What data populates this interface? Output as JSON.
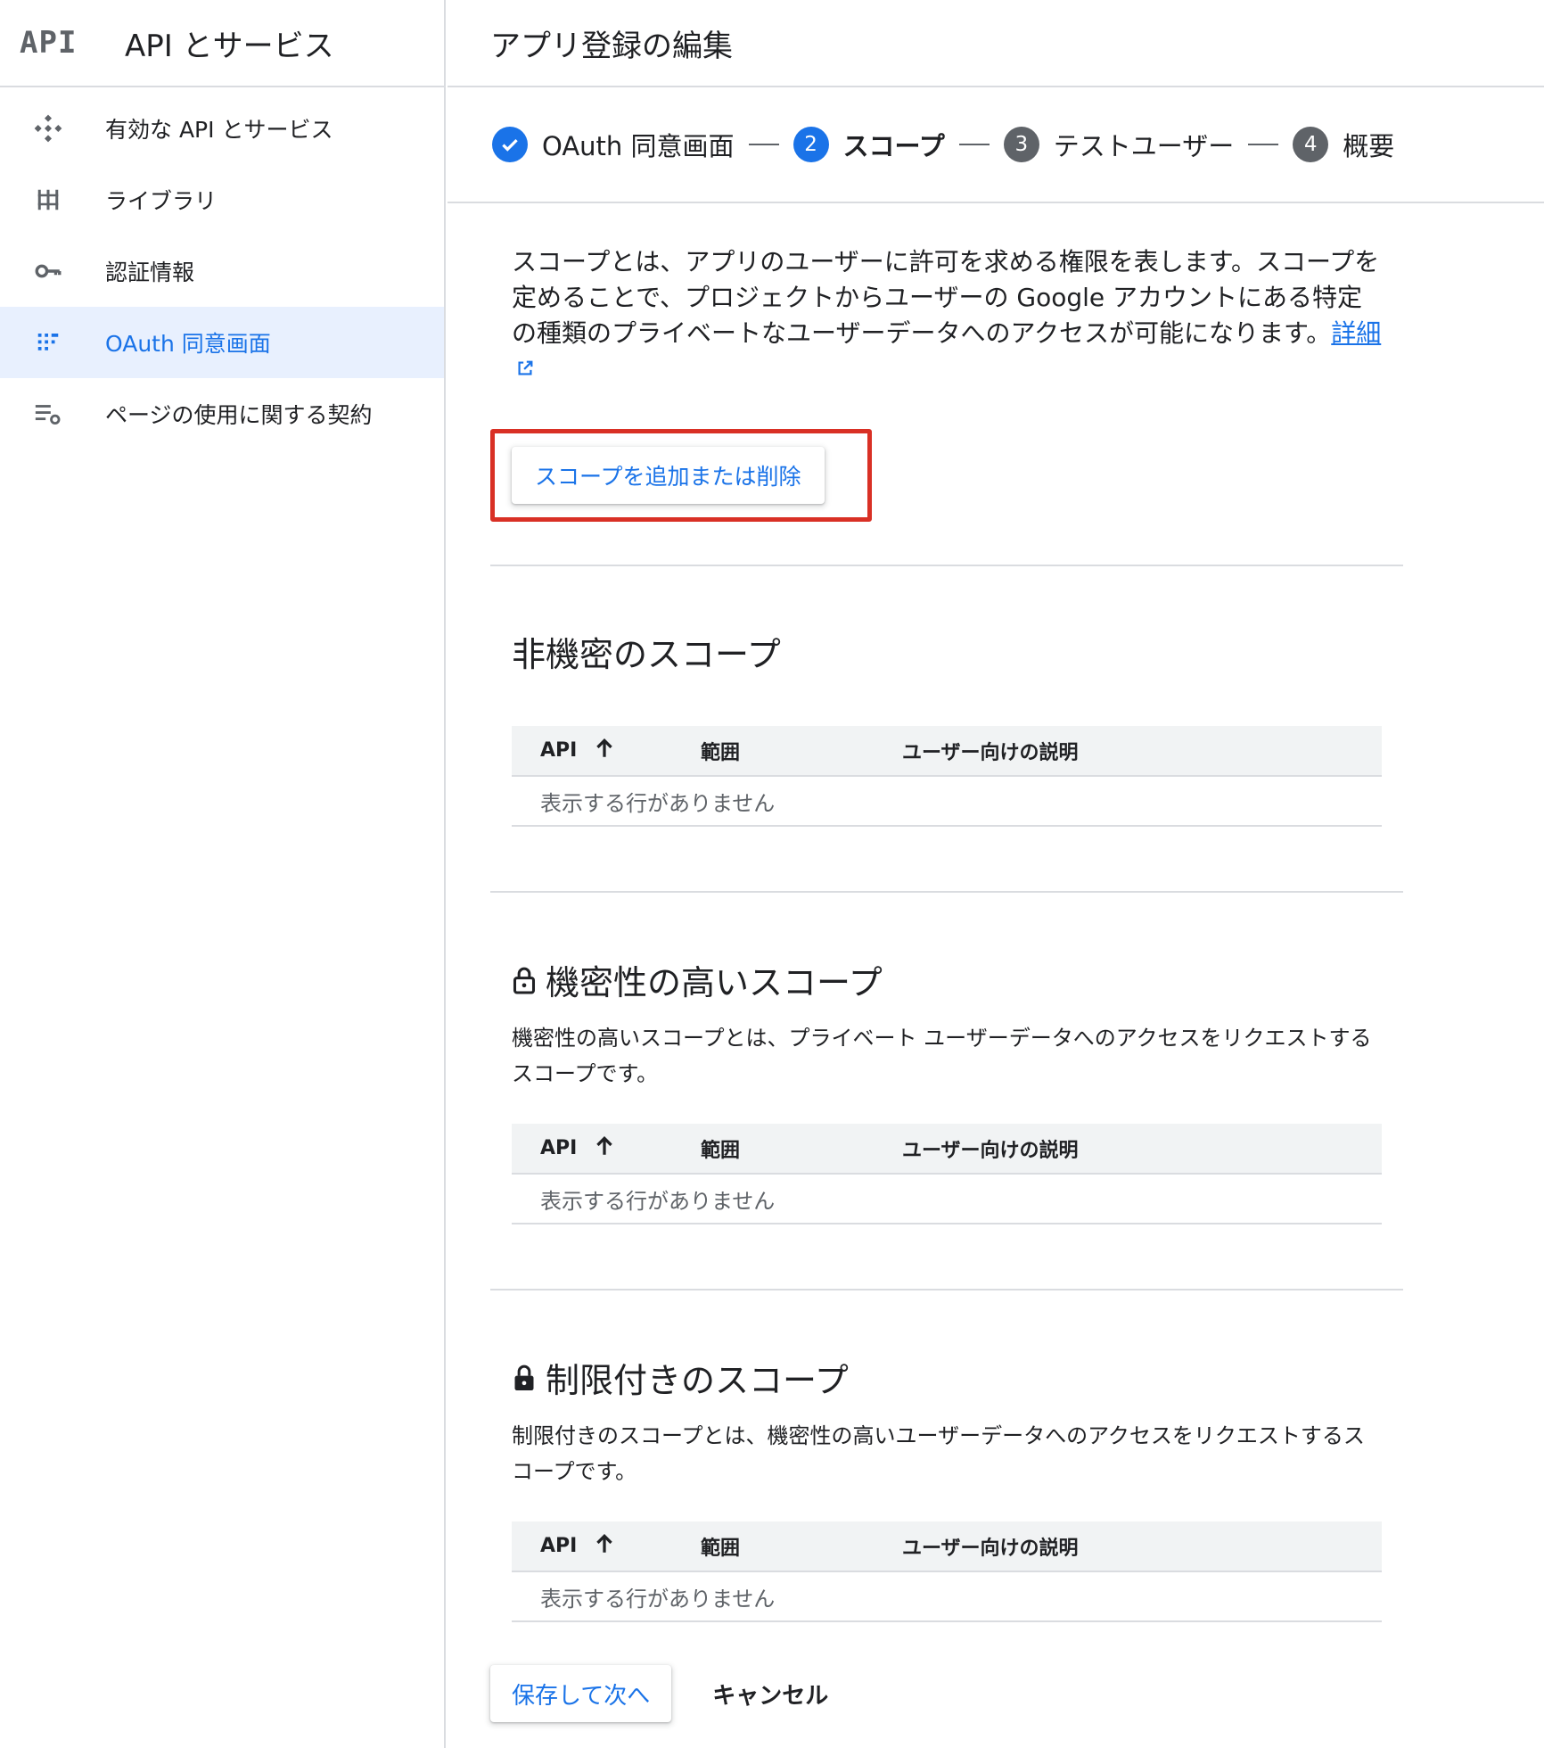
{
  "sidebar": {
    "logo_text": "API",
    "title": "API とサービス",
    "items": [
      {
        "label": "有効な API とサービス",
        "icon": "diamond-grid-icon"
      },
      {
        "label": "ライブラリ",
        "icon": "library-icon"
      },
      {
        "label": "認証情報",
        "icon": "key-icon"
      },
      {
        "label": "OAuth 同意画面",
        "icon": "consent-grid-icon"
      },
      {
        "label": "ページの使用に関する契約",
        "icon": "list-settings-icon"
      }
    ],
    "active_index": 3
  },
  "page": {
    "title": "アプリ登録の編集"
  },
  "stepper": {
    "steps": [
      {
        "label": "OAuth 同意画面",
        "state": "done"
      },
      {
        "number": "2",
        "label": "スコープ",
        "state": "current"
      },
      {
        "number": "3",
        "label": "テストユーザー",
        "state": "future"
      },
      {
        "number": "4",
        "label": "概要",
        "state": "future"
      }
    ]
  },
  "intro": {
    "text": "スコープとは、アプリのユーザーに許可を求める権限を表します。スコープを定めることで、プロジェクトからユーザーの Google アカウントにある特定の種類のプライベートなユーザーデータへのアクセスが可能になります。",
    "link_text": "詳細"
  },
  "add_scope_button": "スコープを追加または削除",
  "table": {
    "col_api": "API",
    "col_scope": "範囲",
    "col_desc": "ユーザー向けの説明",
    "empty_text": "表示する行がありません"
  },
  "sections": {
    "non_sensitive": {
      "title": "非機密のスコープ"
    },
    "sensitive": {
      "title": "機密性の高いスコープ",
      "description": "機密性の高いスコープとは、プライベート ユーザーデータへのアクセスをリクエストするスコープです。"
    },
    "restricted": {
      "title": "制限付きのスコープ",
      "description": "制限付きのスコープとは、機密性の高いユーザーデータへのアクセスをリクエストするスコープです。"
    }
  },
  "footer": {
    "save_label": "保存して次へ",
    "cancel_label": "キャンセル"
  },
  "colors": {
    "accent": "#1a73e8",
    "highlight": "#d93025",
    "active_nav_bg": "#e8f0fe",
    "table_header_bg": "#f1f3f4"
  }
}
